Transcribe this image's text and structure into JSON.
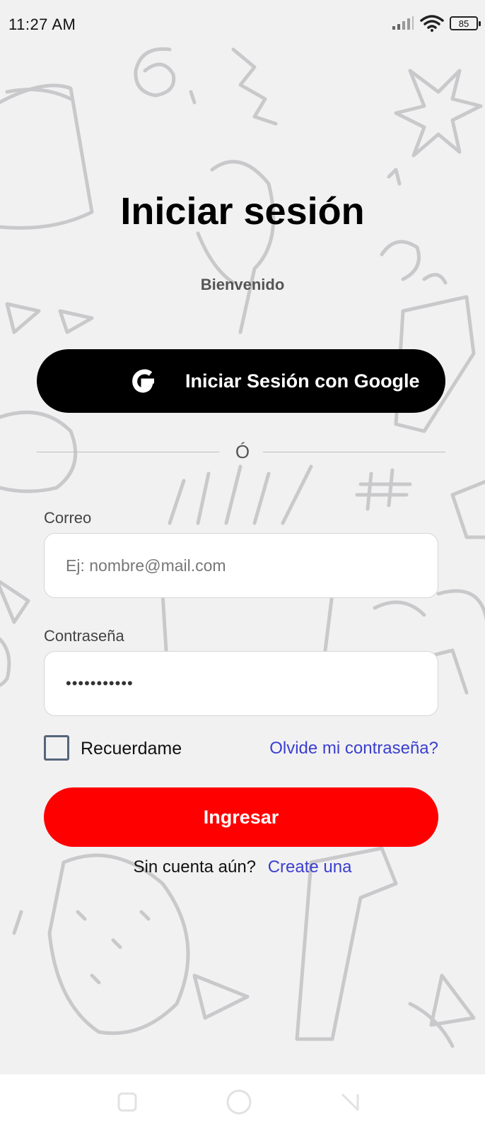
{
  "status_bar": {
    "time": "11:27 AM",
    "battery": "85",
    "icons": [
      "signal-icon",
      "wifi-icon",
      "battery-icon"
    ]
  },
  "login": {
    "title": "Iniciar sesión",
    "subtitle": "Bienvenido",
    "google_button": "Iniciar Sesión con Google",
    "divider_text": "Ó",
    "email_label": "Correo",
    "email_placeholder": "Ej: nombre@mail.com",
    "email_value": "",
    "password_label": "Contraseña",
    "password_value_masked": "•••••••••••",
    "remember_label": "Recuerdame",
    "remember_checked": false,
    "forgot_link": "Olvide mi contraseña?",
    "submit_button": "Ingresar",
    "signup_prompt": "Sin cuenta aún?",
    "signup_link": "Create una"
  },
  "colors": {
    "background": "#f1f1f2",
    "google_button": "#000000",
    "primary_button": "#ff0000",
    "link": "#3b3fce",
    "doodle_stroke": "#c9c9cb"
  },
  "nav_bar": {
    "icons": [
      "recents-square-icon",
      "home-circle-icon",
      "back-triangle-icon"
    ]
  }
}
